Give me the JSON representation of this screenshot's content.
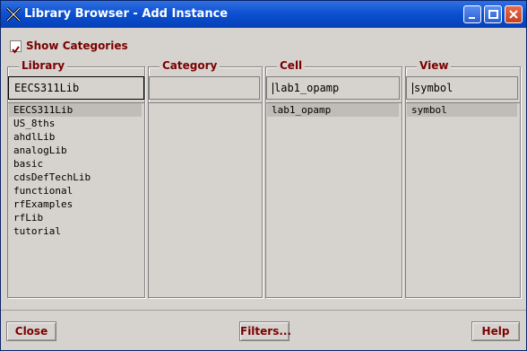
{
  "window": {
    "title": "Library Browser - Add Instance"
  },
  "options": {
    "show_categories_label": "Show Categories",
    "show_categories_checked": true
  },
  "library": {
    "label": "Library",
    "field_value": "EECS311Lib",
    "items": [
      "EECS311Lib",
      "US_8ths",
      "ahdlLib",
      "analogLib",
      "basic",
      "cdsDefTechLib",
      "functional",
      "rfExamples",
      "rfLib",
      "tutorial"
    ],
    "selected_index": 0
  },
  "category": {
    "label": "Category",
    "field_value": ""
  },
  "cell": {
    "label": "Cell",
    "field_value": "lab1_opamp",
    "items": [
      "lab1_opamp"
    ],
    "selected_index": 0
  },
  "view": {
    "label": "View",
    "field_value": "symbol",
    "items": [
      "symbol"
    ],
    "selected_index": 0
  },
  "buttons": {
    "close": "Close",
    "filters": "Filters...",
    "help": "Help"
  },
  "colors": {
    "title_bar": "#0a4fd0",
    "label_text": "#7a0000",
    "background": "#d6d3ce"
  }
}
